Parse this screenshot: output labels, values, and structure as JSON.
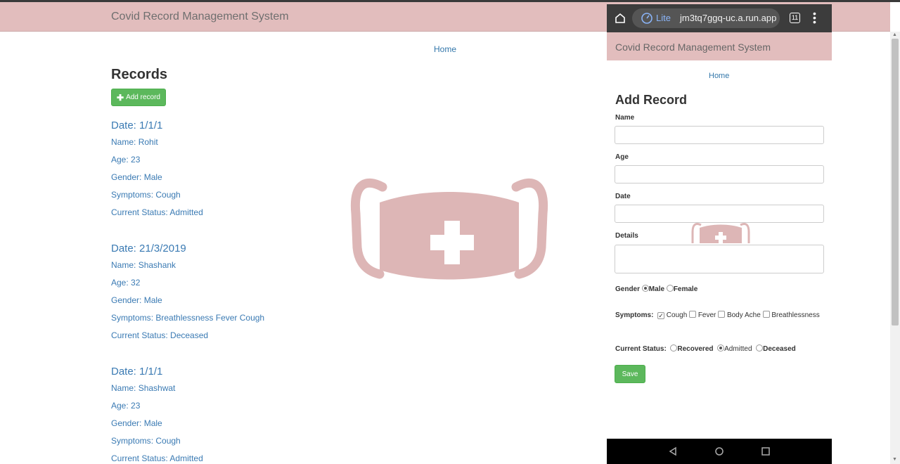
{
  "navbar": {
    "brand": "Covid Record Management System"
  },
  "nav": {
    "home": "Home"
  },
  "records": {
    "title": "Records",
    "add_button": "Add record",
    "labels": {
      "name": "Name",
      "age": "Age",
      "gender": "Gender",
      "symptoms": "Symptoms",
      "status": "Current Status"
    },
    "items": [
      {
        "date": "Date: 1/1/1",
        "name": "Rohit",
        "age": "23",
        "gender": "Male",
        "symptoms": "Cough",
        "status": "Admitted"
      },
      {
        "date": "Date: 21/3/2019",
        "name": "Shashank",
        "age": "32",
        "gender": "Male",
        "symptoms": "Breathlessness Fever Cough",
        "status": "Deceased"
      },
      {
        "date": "Date: 1/1/1",
        "name": "Shashwat",
        "age": "23",
        "gender": "Male",
        "symptoms": "Cough",
        "status": "Admitted"
      }
    ]
  },
  "phone": {
    "browser": {
      "mode": "Lite",
      "url": "jm3tq7ggq-uc.a.run.app",
      "tab_count": "11"
    },
    "brand": "Covid Record Management System",
    "home": "Home",
    "form": {
      "title": "Add Record",
      "name_label": "Name",
      "age_label": "Age",
      "date_label": "Date",
      "details_label": "Details",
      "gender_label": "Gender",
      "gender_options": [
        "Male",
        "Female"
      ],
      "gender_selected": "Male",
      "symptoms_label": "Symptoms:",
      "symptoms": [
        {
          "label": "Cough",
          "checked": true
        },
        {
          "label": "Fever",
          "checked": false
        },
        {
          "label": "Body Ache",
          "checked": false
        },
        {
          "label": "Breathlessness",
          "checked": false
        }
      ],
      "status_label": "Current Status:",
      "status_options": [
        "Recovered",
        "Admitted",
        "Deceased"
      ],
      "status_selected": "Admitted",
      "save": "Save"
    }
  },
  "colors": {
    "navbar": "#e2bdbd",
    "link": "#3a7ab3",
    "button": "#5cb85c",
    "logo": "#ddb6b6"
  }
}
